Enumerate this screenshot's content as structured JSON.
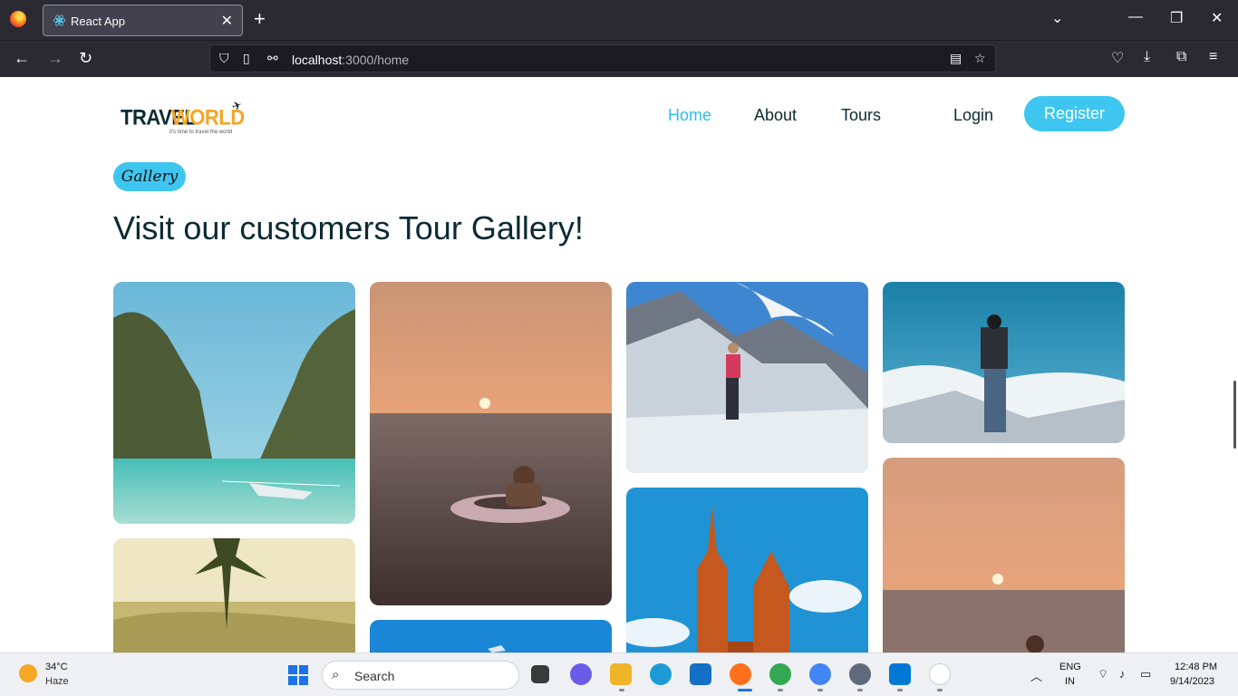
{
  "browser": {
    "tab_title": "React App",
    "url_host": "localhost",
    "url_rest": ":3000/home"
  },
  "site": {
    "logo_travel": "TRAVEL",
    "logo_world": "WORLD",
    "logo_tagline": "it's time to travel the world",
    "nav": [
      {
        "label": "Home",
        "active": true
      },
      {
        "label": "About",
        "active": false
      },
      {
        "label": "Tours",
        "active": false
      }
    ],
    "login_label": "Login",
    "register_label": "Register",
    "accent_color": "#3ec6f0"
  },
  "gallery": {
    "badge": "Gallery",
    "heading": "Visit our customers Tour Gallery!",
    "photos": [
      {
        "subject": "tropical lagoon with boat"
      },
      {
        "subject": "sunset sea with swim ring"
      },
      {
        "subject": "hiker on snowy mountain"
      },
      {
        "subject": "backpacker above clouds"
      },
      {
        "subject": "tree over misty valley"
      },
      {
        "subject": "blue sky with plane"
      },
      {
        "subject": "church towers under blue sky"
      },
      {
        "subject": "sunset sea"
      }
    ]
  },
  "taskbar": {
    "weather_temp": "34°C",
    "weather_cond": "Haze",
    "search_label": "Search",
    "lang_line1": "ENG",
    "lang_line2": "IN",
    "time": "12:48 PM",
    "date": "9/14/2023"
  }
}
